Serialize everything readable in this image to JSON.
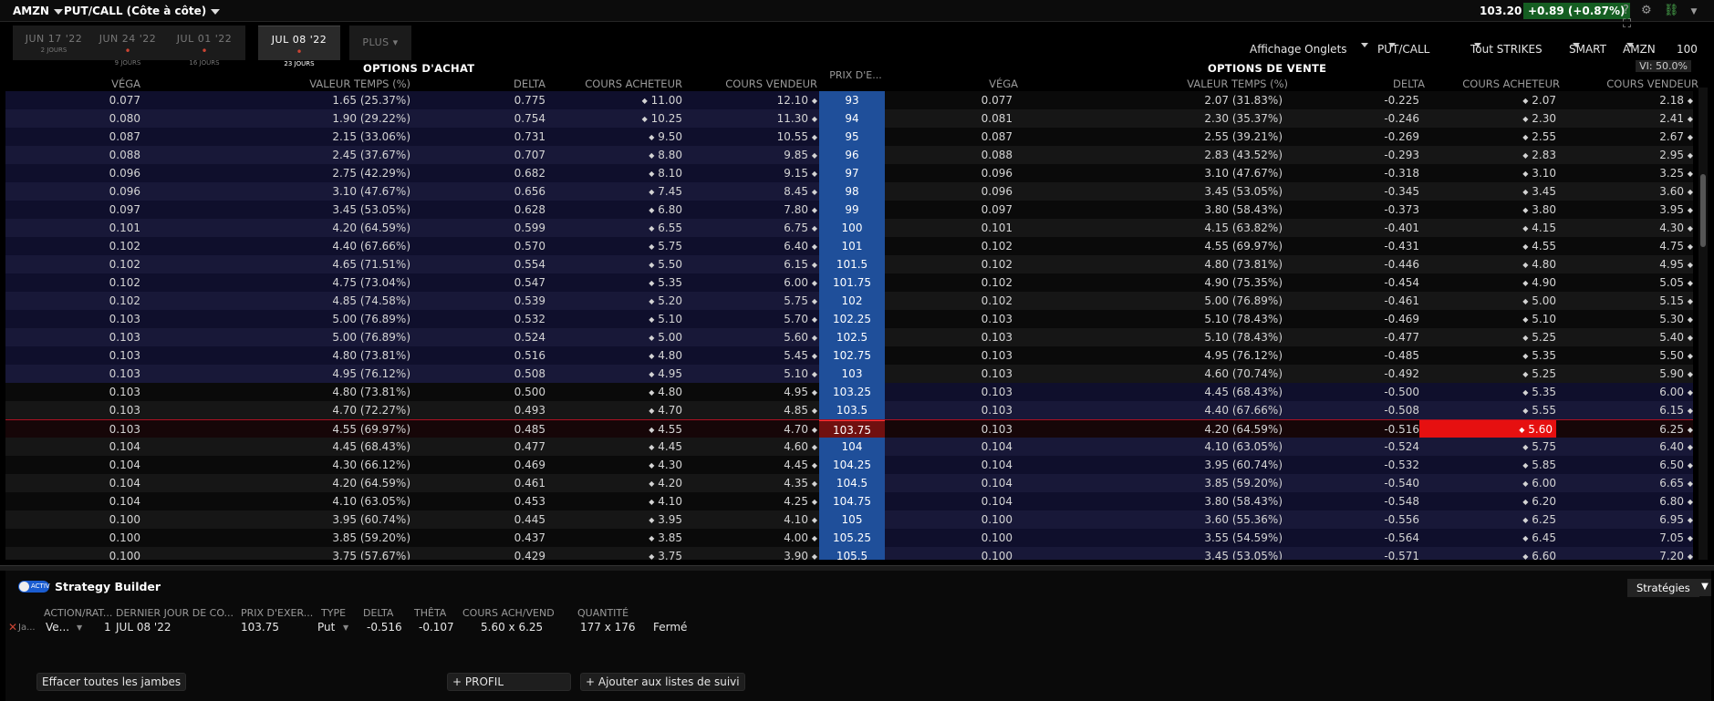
{
  "header": {
    "ticker": "AMZN",
    "mode": "PUT/CALL (Côte à côte)",
    "last": "103.20",
    "change": "+0.89 (+0.87%)",
    "help": "?"
  },
  "tabs": [
    {
      "label": "JUN 17 '22",
      "days": "2 JOURS",
      "dot": "",
      "active": false
    },
    {
      "label": "JUN 24 '22",
      "days": "9 JOURS",
      "dot": "•",
      "active": false
    },
    {
      "label": "JUL 01 '22",
      "days": "16 JOURS",
      "dot": "•",
      "active": false
    },
    {
      "label": "JUL 08 '22",
      "days": "23 JOURS",
      "dot": "•",
      "active": true
    }
  ],
  "more_label": "PLUS",
  "filters": {
    "view": "Affichage Onglets",
    "type": "PUT/CALL",
    "strikes": "Tout STRIKES",
    "exchange": "SMART",
    "symbol": "AMZN",
    "multiplier": "100"
  },
  "vi": "VI: 50.0%",
  "headers": {
    "calls": "OPTIONS D'ACHAT",
    "puts": "OPTIONS DE VENTE",
    "strike": "PRIX D'E...",
    "vega": "VÉGA",
    "time_value": "VALEUR TEMPS (%)",
    "delta": "DELTA",
    "bid": "COURS ACHETEUR",
    "ask": "COURS VENDEUR"
  },
  "diamond": "◆",
  "rows": [
    {
      "strike": "93",
      "c": [
        "0.077",
        "1.65 (25.37%)",
        "0.775",
        "11.00",
        "12.10"
      ],
      "p": [
        "0.077",
        "2.07 (31.83%)",
        "-0.225",
        "2.07",
        "2.18"
      ]
    },
    {
      "strike": "94",
      "c": [
        "0.080",
        "1.90 (29.22%)",
        "0.754",
        "10.25",
        "11.30"
      ],
      "p": [
        "0.081",
        "2.30 (35.37%)",
        "-0.246",
        "2.30",
        "2.41"
      ]
    },
    {
      "strike": "95",
      "c": [
        "0.087",
        "2.15 (33.06%)",
        "0.731",
        "9.50",
        "10.55"
      ],
      "p": [
        "0.087",
        "2.55 (39.21%)",
        "-0.269",
        "2.55",
        "2.67"
      ]
    },
    {
      "strike": "96",
      "c": [
        "0.088",
        "2.45 (37.67%)",
        "0.707",
        "8.80",
        "9.85"
      ],
      "p": [
        "0.088",
        "2.83 (43.52%)",
        "-0.293",
        "2.83",
        "2.95"
      ]
    },
    {
      "strike": "97",
      "c": [
        "0.096",
        "2.75 (42.29%)",
        "0.682",
        "8.10",
        "9.15"
      ],
      "p": [
        "0.096",
        "3.10 (47.67%)",
        "-0.318",
        "3.10",
        "3.25"
      ]
    },
    {
      "strike": "98",
      "c": [
        "0.096",
        "3.10 (47.67%)",
        "0.656",
        "7.45",
        "8.45"
      ],
      "p": [
        "0.096",
        "3.45 (53.05%)",
        "-0.345",
        "3.45",
        "3.60"
      ]
    },
    {
      "strike": "99",
      "c": [
        "0.097",
        "3.45 (53.05%)",
        "0.628",
        "6.80",
        "7.80"
      ],
      "p": [
        "0.097",
        "3.80 (58.43%)",
        "-0.373",
        "3.80",
        "3.95"
      ]
    },
    {
      "strike": "100",
      "c": [
        "0.101",
        "4.20 (64.59%)",
        "0.599",
        "6.55",
        "6.75"
      ],
      "p": [
        "0.101",
        "4.15 (63.82%)",
        "-0.401",
        "4.15",
        "4.30"
      ]
    },
    {
      "strike": "101",
      "c": [
        "0.102",
        "4.40 (67.66%)",
        "0.570",
        "5.75",
        "6.40"
      ],
      "p": [
        "0.102",
        "4.55 (69.97%)",
        "-0.431",
        "4.55",
        "4.75"
      ]
    },
    {
      "strike": "101.5",
      "c": [
        "0.102",
        "4.65 (71.51%)",
        "0.554",
        "5.50",
        "6.15"
      ],
      "p": [
        "0.102",
        "4.80 (73.81%)",
        "-0.446",
        "4.80",
        "4.95"
      ]
    },
    {
      "strike": "101.75",
      "c": [
        "0.102",
        "4.75 (73.04%)",
        "0.547",
        "5.35",
        "6.00"
      ],
      "p": [
        "0.102",
        "4.90 (75.35%)",
        "-0.454",
        "4.90",
        "5.05"
      ]
    },
    {
      "strike": "102",
      "c": [
        "0.102",
        "4.85 (74.58%)",
        "0.539",
        "5.20",
        "5.75"
      ],
      "p": [
        "0.102",
        "5.00 (76.89%)",
        "-0.461",
        "5.00",
        "5.15"
      ]
    },
    {
      "strike": "102.25",
      "c": [
        "0.103",
        "5.00 (76.89%)",
        "0.532",
        "5.10",
        "5.70"
      ],
      "p": [
        "0.103",
        "5.10 (78.43%)",
        "-0.469",
        "5.10",
        "5.30"
      ]
    },
    {
      "strike": "102.5",
      "c": [
        "0.103",
        "5.00 (76.89%)",
        "0.524",
        "5.00",
        "5.60"
      ],
      "p": [
        "0.103",
        "5.10 (78.43%)",
        "-0.477",
        "5.25",
        "5.40"
      ]
    },
    {
      "strike": "102.75",
      "c": [
        "0.103",
        "4.80 (73.81%)",
        "0.516",
        "4.80",
        "5.45"
      ],
      "p": [
        "0.103",
        "4.95 (76.12%)",
        "-0.485",
        "5.35",
        "5.50"
      ]
    },
    {
      "strike": "103",
      "c": [
        "0.103",
        "4.95 (76.12%)",
        "0.508",
        "4.95",
        "5.10"
      ],
      "p": [
        "0.103",
        "4.60 (70.74%)",
        "-0.492",
        "5.25",
        "5.90"
      ]
    },
    {
      "strike": "103.25",
      "c": [
        "0.103",
        "4.80 (73.81%)",
        "0.500",
        "4.80",
        "4.95"
      ],
      "p": [
        "0.103",
        "4.45 (68.43%)",
        "-0.500",
        "5.35",
        "6.00"
      ]
    },
    {
      "strike": "103.5",
      "c": [
        "0.103",
        "4.70 (72.27%)",
        "0.493",
        "4.70",
        "4.85"
      ],
      "p": [
        "0.103",
        "4.40 (67.66%)",
        "-0.508",
        "5.55",
        "6.15"
      ]
    },
    {
      "strike": "103.75",
      "atm": true,
      "c": [
        "0.103",
        "4.55 (69.97%)",
        "0.485",
        "4.55",
        "4.70"
      ],
      "p": [
        "0.103",
        "4.20 (64.59%)",
        "-0.516",
        "5.60",
        "6.25"
      ]
    },
    {
      "strike": "104",
      "c": [
        "0.104",
        "4.45 (68.43%)",
        "0.477",
        "4.45",
        "4.60"
      ],
      "p": [
        "0.104",
        "4.10 (63.05%)",
        "-0.524",
        "5.75",
        "6.40"
      ]
    },
    {
      "strike": "104.25",
      "c": [
        "0.104",
        "4.30 (66.12%)",
        "0.469",
        "4.30",
        "4.45"
      ],
      "p": [
        "0.104",
        "3.95 (60.74%)",
        "-0.532",
        "5.85",
        "6.50"
      ]
    },
    {
      "strike": "104.5",
      "c": [
        "0.104",
        "4.20 (64.59%)",
        "0.461",
        "4.20",
        "4.35"
      ],
      "p": [
        "0.104",
        "3.85 (59.20%)",
        "-0.540",
        "6.00",
        "6.65"
      ]
    },
    {
      "strike": "104.75",
      "c": [
        "0.104",
        "4.10 (63.05%)",
        "0.453",
        "4.10",
        "4.25"
      ],
      "p": [
        "0.104",
        "3.80 (58.43%)",
        "-0.548",
        "6.20",
        "6.80"
      ]
    },
    {
      "strike": "105",
      "c": [
        "0.100",
        "3.95 (60.74%)",
        "0.445",
        "3.95",
        "4.10"
      ],
      "p": [
        "0.100",
        "3.60 (55.36%)",
        "-0.556",
        "6.25",
        "6.95"
      ]
    },
    {
      "strike": "105.25",
      "c": [
        "0.100",
        "3.85 (59.20%)",
        "0.437",
        "3.85",
        "4.00"
      ],
      "p": [
        "0.100",
        "3.55 (54.59%)",
        "-0.564",
        "6.45",
        "7.05"
      ]
    },
    {
      "strike": "105.5",
      "c": [
        "0.100",
        "3.75 (57.67%)",
        "0.429",
        "3.75",
        "3.90"
      ],
      "p": [
        "0.100",
        "3.45 (53.05%)",
        "-0.571",
        "6.60",
        "7.20"
      ]
    }
  ],
  "strategy": {
    "toggle": "ACTIV",
    "title": "Strategy Builder",
    "strategies_label": "Stratégies",
    "cols": {
      "action": "ACTION/RAT...",
      "last_day": "DERNIER JOUR DE CO...",
      "strike": "PRIX D'EXER...",
      "type": "TYPE",
      "delta": "DELTA",
      "theta": "THÊTA",
      "bidask": "COURS ACH/VEND",
      "qty": "QUANTITÉ"
    },
    "leg": {
      "remove": "✕",
      "side": "Ja...",
      "action": "Ve...",
      "ratio": "1",
      "last_day": "JUL 08 '22",
      "strike": "103.75",
      "type": "Put",
      "delta": "-0.516",
      "theta": "-0.107",
      "bidask": "5.60 x 6.25",
      "qty": "177 x 176",
      "status": "Fermé"
    },
    "clear_label": "Effacer toutes les jambes",
    "profile_label": "+ PROFIL",
    "watchlist_label": "+ Ajouter aux listes de suivi"
  }
}
